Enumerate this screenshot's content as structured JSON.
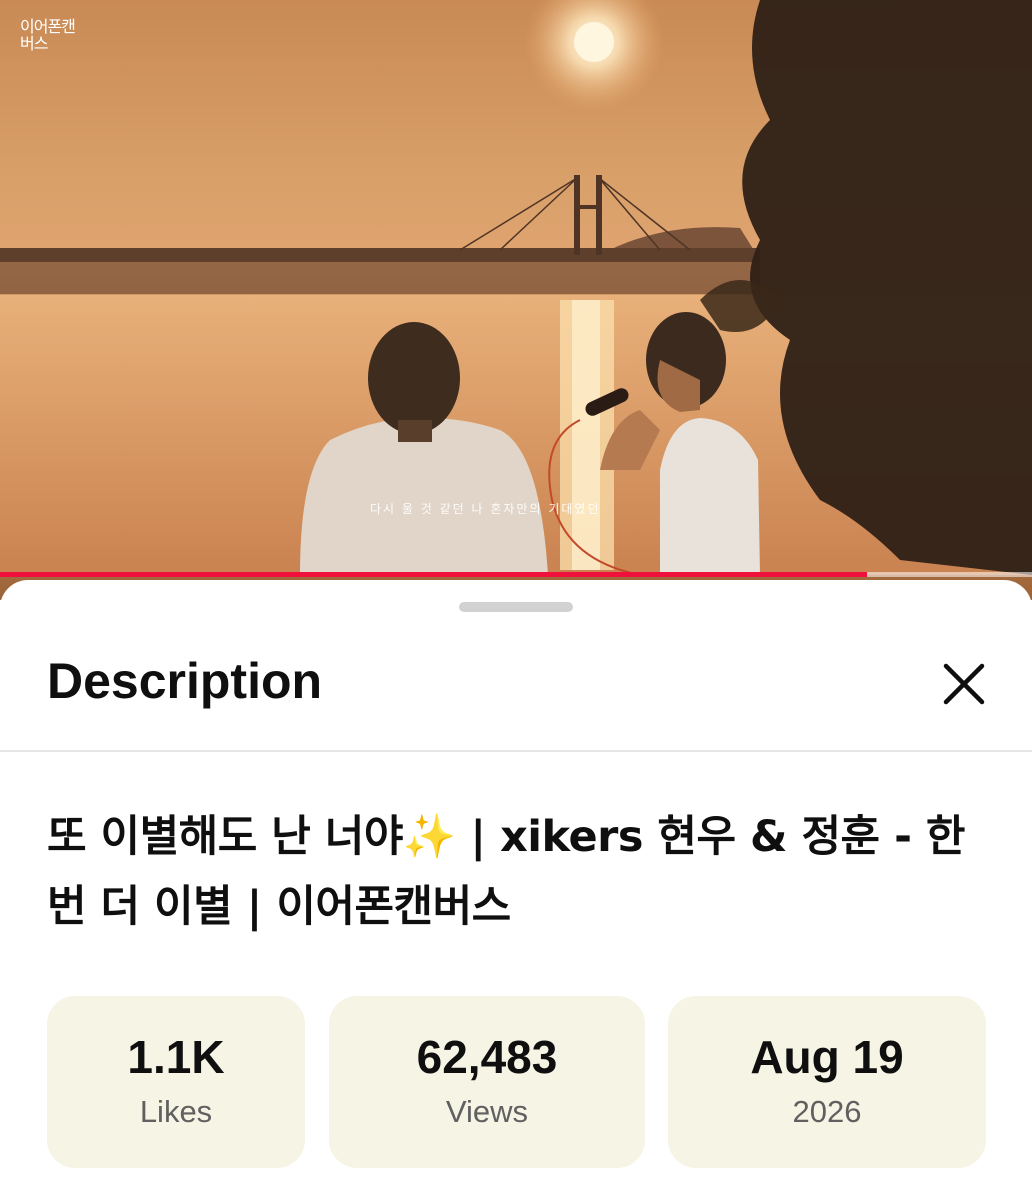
{
  "video": {
    "channel_logo": "이어폰캔버스",
    "subtitle": "다시 울 것 같던 나 혼자만의 기대였던",
    "progress": 0.84,
    "colors": {
      "progress": "#f0103c",
      "track": "#ffffff"
    }
  },
  "sheet": {
    "title": "Description",
    "close_icon": "close-icon"
  },
  "description": {
    "video_title": "또 이별해도 난 너야✨ | xikers 현우 & 정훈 - 한번 더 이별 | 이어폰캔버스",
    "stats": [
      {
        "value": "1.1K",
        "label": "Likes"
      },
      {
        "value": "62,483",
        "label": "Views"
      },
      {
        "value": "Aug 19",
        "label": "2026"
      }
    ]
  },
  "colors": {
    "card_bg": "#f6f4e4",
    "text_primary": "#0f0f0f",
    "text_secondary": "#606060"
  }
}
